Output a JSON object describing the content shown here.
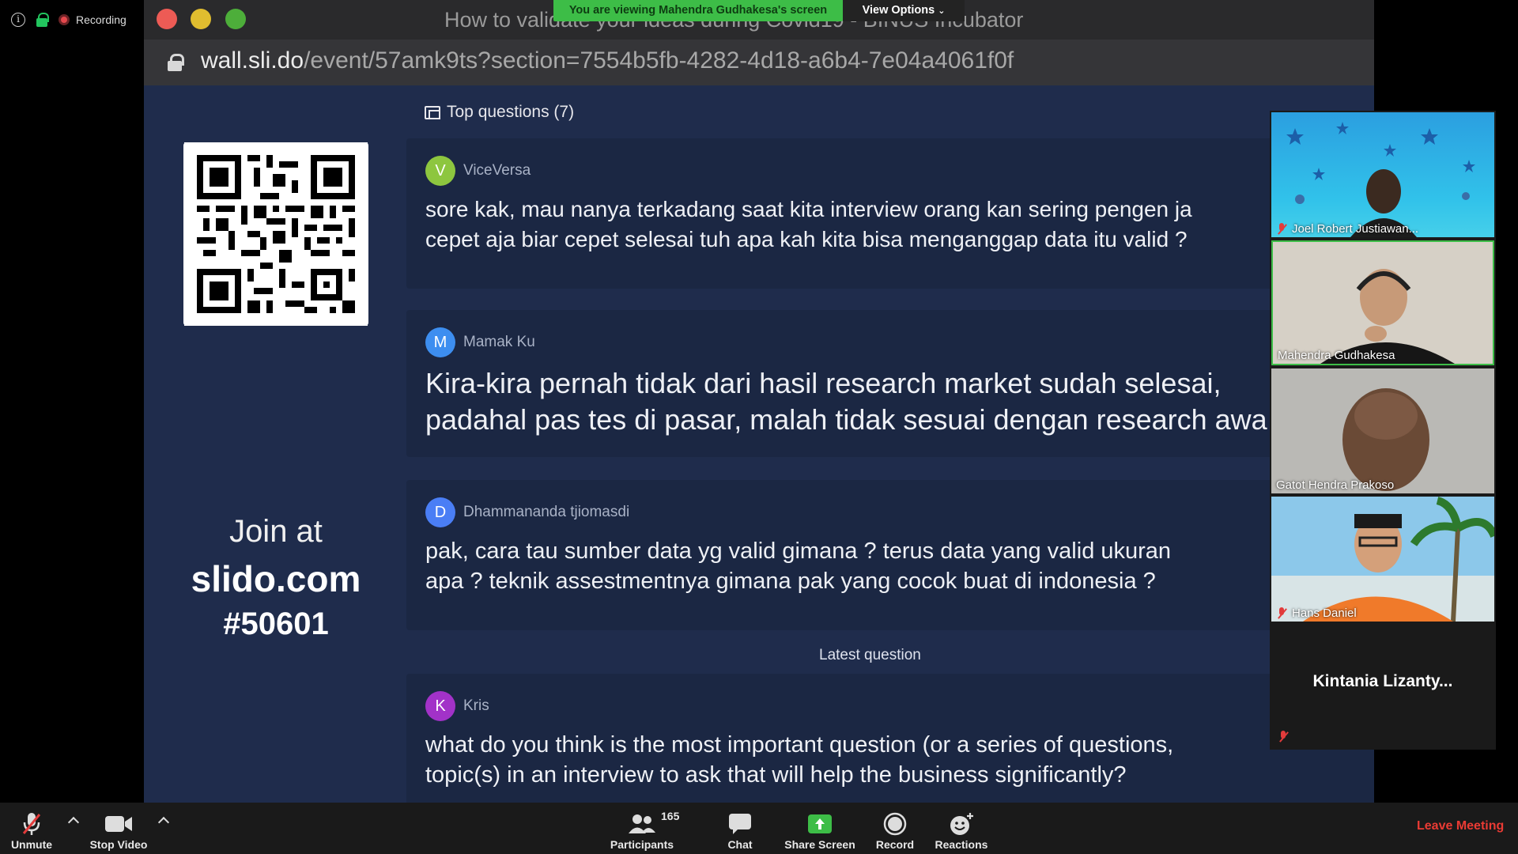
{
  "status": {
    "recording_label": "Recording"
  },
  "window": {
    "title": "How to validate your ideas during Covid19 - BINUS Incubator",
    "url_host": "wall.sli.do",
    "url_path": "/event/57amk9ts?section=7554b5fb-4282-4d18-a6b4-7e04a4061f0f"
  },
  "banner": {
    "viewing": "You are viewing Mahendra Gudhakesa's screen",
    "view_options": "View Options"
  },
  "slido": {
    "join_line1": "Join at",
    "join_line2": "slido.com",
    "join_line3": "#50601",
    "top_questions_label": "Top questions (7)",
    "latest_label": "Latest question",
    "questions": [
      {
        "initial": "V",
        "author": "ViceVersa",
        "avatar_color": "#8dc63f",
        "line1": "sore kak, mau nanya terkadang saat kita interview orang kan sering pengen ja",
        "line2": "cepet aja biar cepet selesai tuh apa kah kita bisa menganggap data itu valid ?"
      },
      {
        "initial": "M",
        "author": "Mamak Ku",
        "avatar_color": "#3d8ef0",
        "line1": "Kira-kira pernah tidak dari hasil research market sudah selesai,",
        "line2": "padahal pas tes di pasar, malah tidak sesuai dengan research awa"
      },
      {
        "initial": "D",
        "author": "Dhammananda tjiomasdi",
        "avatar_color": "#4a7ef5",
        "line1": "pak, cara tau sumber data yg valid gimana ? terus data yang valid ukuran",
        "line2": "apa ? teknik assestmentnya gimana pak yang cocok buat di indonesia ?"
      },
      {
        "initial": "K",
        "author": "Kris",
        "avatar_color": "#a232c8",
        "line1": "what do you think is the most important question (or a series of questions,",
        "line2": "topic(s) in an interview to ask that will help the business significantly?"
      }
    ]
  },
  "participants_videos": [
    {
      "name": "Joel Robert Justiawan...",
      "muted": true
    },
    {
      "name": "Mahendra Gudhakesa",
      "muted": false
    },
    {
      "name": "Gatot Hendra Prakoso",
      "muted": false
    },
    {
      "name": "Hans Daniel",
      "muted": true
    },
    {
      "name": "Kintania  Lizanty...",
      "muted": true
    }
  ],
  "toolbar": {
    "unmute": "Unmute",
    "stop_video": "Stop Video",
    "participants": "Participants",
    "participants_count": "165",
    "chat": "Chat",
    "share_screen": "Share Screen",
    "record": "Record",
    "reactions": "Reactions",
    "leave": "Leave Meeting"
  },
  "colors": {
    "slido_bg": "#1f2c4c",
    "share_green": "#3dbd47",
    "leave_red": "#ea3b34",
    "mute_red": "#e23b3b"
  }
}
